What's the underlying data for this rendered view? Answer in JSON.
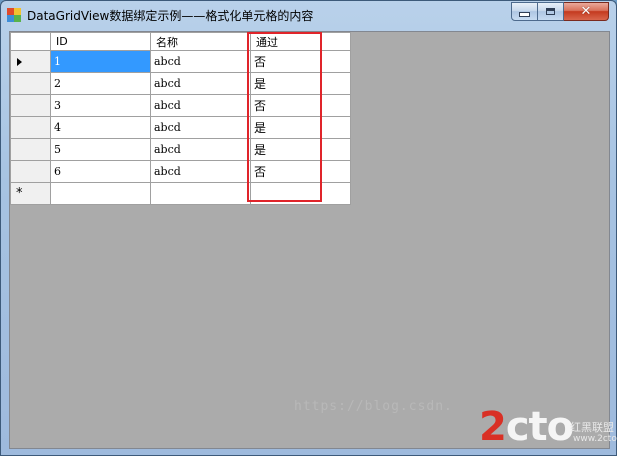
{
  "window": {
    "title": "DataGridView数据绑定示例——格式化单元格的内容",
    "close_glyph": "✕"
  },
  "grid": {
    "columns": [
      "ID",
      "名称",
      "通过"
    ],
    "rows": [
      {
        "id": "1",
        "name": "abcd",
        "passed": "否"
      },
      {
        "id": "2",
        "name": "abcd",
        "passed": "是"
      },
      {
        "id": "3",
        "name": "abcd",
        "passed": "否"
      },
      {
        "id": "4",
        "name": "abcd",
        "passed": "是"
      },
      {
        "id": "5",
        "name": "abcd",
        "passed": "是"
      },
      {
        "id": "6",
        "name": "abcd",
        "passed": "否"
      }
    ],
    "new_row_glyph": "*",
    "selected_row": 0,
    "highlight_color": "#e0242a",
    "selection_color": "#3399ff"
  },
  "watermark": {
    "url": "https://blog.csdn.",
    "logo_accent": "2",
    "logo_rest": "cto",
    "logo_suffix": ".com",
    "site_cn": "红黑联盟",
    "site_domain": "www.2cto.com"
  }
}
